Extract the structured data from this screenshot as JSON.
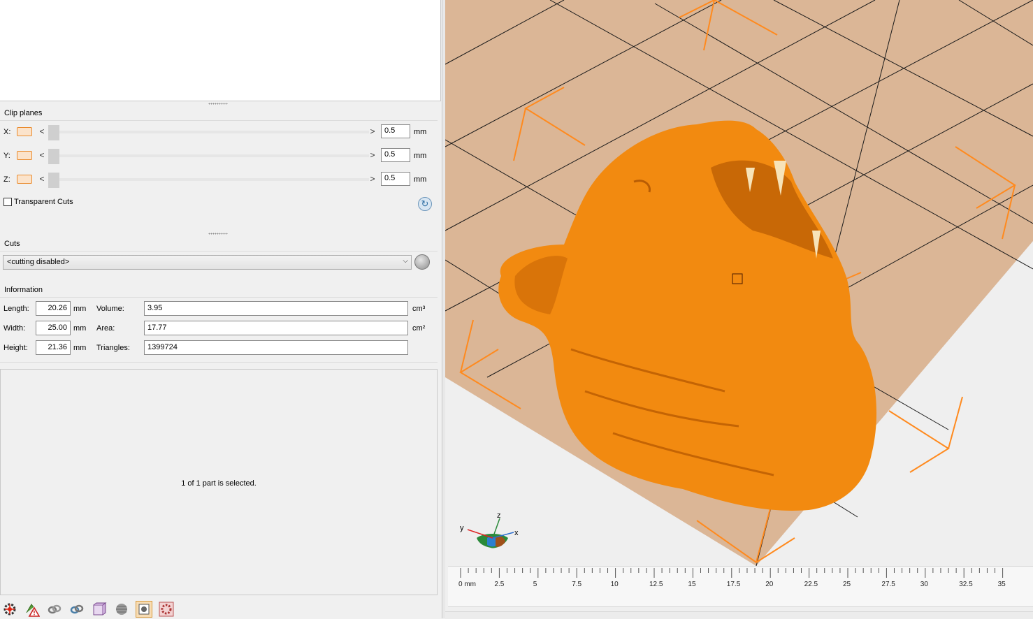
{
  "clip_planes": {
    "title": "Clip planes",
    "axes": [
      {
        "label": "X:",
        "value": "0.5",
        "unit": "mm"
      },
      {
        "label": "Y:",
        "value": "0.5",
        "unit": "mm"
      },
      {
        "label": "Z:",
        "value": "0.5",
        "unit": "mm"
      }
    ],
    "transparent_cuts_label": "Transparent Cuts",
    "transparent_cuts_checked": false,
    "prev_glyph": "<",
    "next_glyph": ">"
  },
  "cuts": {
    "title": "Cuts",
    "selected": "<cutting disabled>"
  },
  "information": {
    "title": "Information",
    "length_label": "Length:",
    "length": "20.26",
    "length_unit": "mm",
    "width_label": "Width:",
    "width": "25.00",
    "width_unit": "mm",
    "height_label": "Height:",
    "height": "21.36",
    "height_unit": "mm",
    "volume_label": "Volume:",
    "volume": "3.95",
    "volume_unit": "cm³",
    "area_label": "Area:",
    "area": "17.77",
    "area_unit": "cm²",
    "triangles_label": "Triangles:",
    "triangles": "1399724"
  },
  "status": {
    "selection_text": "1 of 1 part is selected."
  },
  "toolbar_icons": [
    "gear-icon",
    "edit-warning-icon",
    "link-icon",
    "refresh-link-icon",
    "box-icon",
    "sphere-gray-icon",
    "highlight-box-icon",
    "gear-grid-icon"
  ],
  "viewport": {
    "axis_labels": {
      "y": "y",
      "z": "z",
      "x": "x"
    },
    "ruler_ticks": [
      "0 mm",
      "2.5",
      "5",
      "7.5",
      "10",
      "12.5",
      "15",
      "17.5",
      "20",
      "22.5",
      "25",
      "27.5",
      "30",
      "32.5",
      "35"
    ],
    "colors": {
      "model": "#f28a10",
      "bed": "#dbb696",
      "frame": "#ff8a1e"
    }
  }
}
